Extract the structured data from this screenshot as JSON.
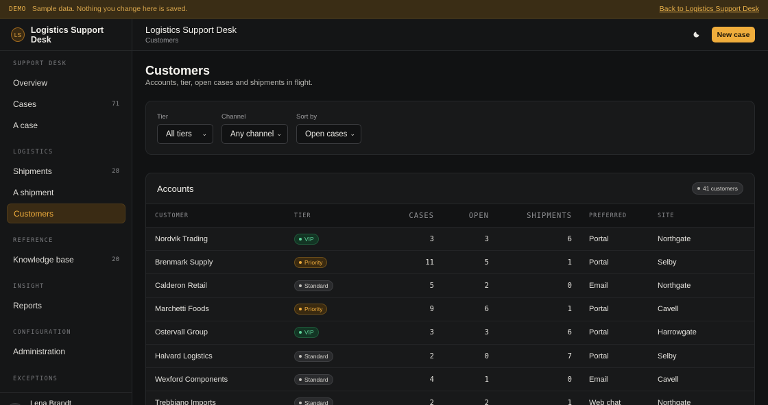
{
  "banner": {
    "tag": "DEMO",
    "message": "Sample data. Nothing you change here is saved.",
    "back_link": "Back to Logistics Support Desk"
  },
  "brand": {
    "initials": "LS",
    "name": "Logistics Support Desk"
  },
  "sidebar": {
    "sections": [
      {
        "label": "SUPPORT DESK"
      },
      {
        "label": "LOGISTICS"
      },
      {
        "label": "REFERENCE"
      },
      {
        "label": "INSIGHT"
      },
      {
        "label": "CONFIGURATION"
      },
      {
        "label": "EXCEPTIONS"
      }
    ],
    "items": [
      {
        "label": "Overview",
        "count": ""
      },
      {
        "label": "Cases",
        "count": "71"
      },
      {
        "label": "A case",
        "count": ""
      },
      {
        "label": "Shipments",
        "count": "28"
      },
      {
        "label": "A shipment",
        "count": ""
      },
      {
        "label": "Customers",
        "count": ""
      },
      {
        "label": "Knowledge base",
        "count": "20"
      },
      {
        "label": "Reports",
        "count": ""
      },
      {
        "label": "Administration",
        "count": ""
      }
    ],
    "active_item": "Customers",
    "user": {
      "initials": "LB",
      "name": "Lena Brandt",
      "logout_icon": "logout-icon"
    }
  },
  "topbar": {
    "title": "Logistics Support Desk",
    "breadcrumb": "Customers",
    "theme_icon": "moon-icon",
    "new_case_label": "New case"
  },
  "page": {
    "title": "Customers",
    "subtitle": "Accounts, tier, open cases and shipments in flight."
  },
  "filters": {
    "tier": {
      "label": "Tier",
      "value": "All tiers"
    },
    "channel": {
      "label": "Channel",
      "value": "Any channel"
    },
    "sort": {
      "label": "Sort by",
      "value": "Open cases"
    }
  },
  "accounts": {
    "title": "Accounts",
    "badge": "41 customers",
    "columns": [
      "CUSTOMER",
      "TIER",
      "CASES",
      "OPEN",
      "SHIPMENTS",
      "PREFERRED",
      "SITE"
    ],
    "rows": [
      {
        "customer": "Nordvik Trading",
        "tier": "VIP",
        "cases": "3",
        "open": "3",
        "shipments": "6",
        "preferred": "Portal",
        "site": "Northgate"
      },
      {
        "customer": "Brenmark Supply",
        "tier": "Priority",
        "cases": "11",
        "open": "5",
        "shipments": "1",
        "preferred": "Portal",
        "site": "Selby"
      },
      {
        "customer": "Calderon Retail",
        "tier": "Standard",
        "cases": "5",
        "open": "2",
        "shipments": "0",
        "preferred": "Email",
        "site": "Northgate"
      },
      {
        "customer": "Marchetti Foods",
        "tier": "Priority",
        "cases": "9",
        "open": "6",
        "shipments": "1",
        "preferred": "Portal",
        "site": "Cavell"
      },
      {
        "customer": "Ostervall Group",
        "tier": "VIP",
        "cases": "3",
        "open": "3",
        "shipments": "6",
        "preferred": "Portal",
        "site": "Harrowgate"
      },
      {
        "customer": "Halvard Logistics",
        "tier": "Standard",
        "cases": "2",
        "open": "0",
        "shipments": "7",
        "preferred": "Portal",
        "site": "Selby"
      },
      {
        "customer": "Wexford Components",
        "tier": "Standard",
        "cases": "4",
        "open": "1",
        "shipments": "0",
        "preferred": "Email",
        "site": "Cavell"
      },
      {
        "customer": "Trebbiano Imports",
        "tier": "Standard",
        "cases": "2",
        "open": "2",
        "shipments": "1",
        "preferred": "Web chat",
        "site": "Northgate"
      }
    ]
  },
  "colors": {
    "accent": "#f0ad3c",
    "banner_bg": "#3a2d15",
    "vip": "#5fd39a",
    "priority": "#f0ad3c",
    "standard": "#d3d1cc"
  }
}
